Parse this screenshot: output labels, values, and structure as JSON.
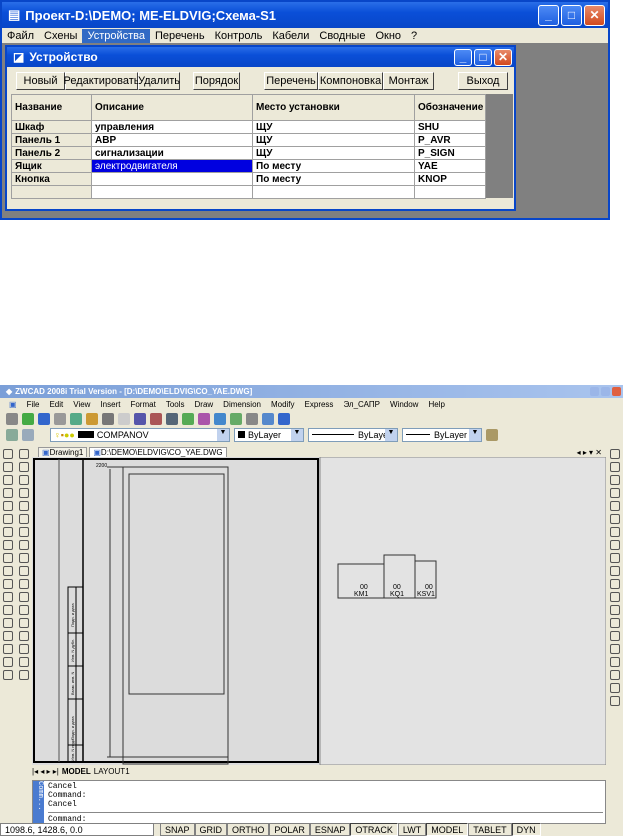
{
  "top_app": {
    "title": "Проект-D:\\DEMO; ME-ELDVIG;Схема-S1",
    "menu": [
      "Файл",
      "Схены",
      "Устройства",
      "Перечень",
      "Контроль",
      "Кабели",
      "Сводные",
      "Окно",
      "?"
    ],
    "dialog": {
      "title": "Устройство",
      "buttons": {
        "new": "Новый",
        "edit": "Редактировать",
        "delete": "Удалить",
        "order": "Порядок",
        "list": "Перечень",
        "layout": "Компоновка",
        "mount": "Монтаж",
        "exit": "Выход"
      },
      "columns": [
        "Название",
        "Описание",
        "Место установки",
        "Обозначение"
      ],
      "rows": [
        {
          "name": "Шкаф",
          "desc": "управления",
          "place": "ЩУ",
          "code": "SHU"
        },
        {
          "name": "Панель 1",
          "desc": "АВР",
          "place": "ЩУ",
          "code": "P_AVR"
        },
        {
          "name": "Панель 2",
          "desc": "сигнализации",
          "place": "ЩУ",
          "code": "P_SIGN"
        },
        {
          "name": "Ящик",
          "desc": "электродвигателя",
          "place": "По месту",
          "code": "YAE"
        },
        {
          "name": "Кнопка",
          "desc": "",
          "place": "По месту",
          "code": "KNOP"
        }
      ]
    }
  },
  "cad": {
    "title": "ZWCAD 2008i Trial Version - [D:\\DEMO\\ELDVIG\\CO_YAE.DWG]",
    "menu": [
      "File",
      "Edit",
      "View",
      "Insert",
      "Format",
      "Tools",
      "Draw",
      "Dimension",
      "Modify",
      "Express",
      "Эл_САПР",
      "Window",
      "Help"
    ],
    "layer": "COMPANOV",
    "color": "ByLayer",
    "linetype": "ByLayer",
    "lineweight": "ByLayer",
    "doc_tabs": [
      "Drawing1",
      "D:\\DEMO\\ELDVIG\\CO_YAE.DWG"
    ],
    "dim_label": "2200",
    "stamp": [
      "Подп. и дата",
      "Инв. N дубл.",
      "Взам. инв. N",
      "Подп. и дата",
      "Инв. N подл."
    ],
    "blocks": [
      {
        "top": "00",
        "label": "KM1"
      },
      {
        "top": "00",
        "label": "KQ1"
      },
      {
        "top": "00",
        "label": "KSV1"
      }
    ],
    "layout_tabs": [
      "MODEL",
      "LAYOUT1"
    ],
    "command_side": "Comm...",
    "command_history": [
      "Cancel",
      "Command:",
      "Cancel"
    ],
    "command_prompt": "Command:",
    "coords": "1098.6,  1428.6,  0.0",
    "status": [
      "SNAP",
      "GRID",
      "ORTHO",
      "POLAR",
      "ESNAP",
      "OTRACK",
      "LWT",
      "MODEL",
      "TABLET",
      "DYN"
    ],
    "status_on": [
      "OTRACK",
      "MODEL",
      "DYN"
    ]
  }
}
